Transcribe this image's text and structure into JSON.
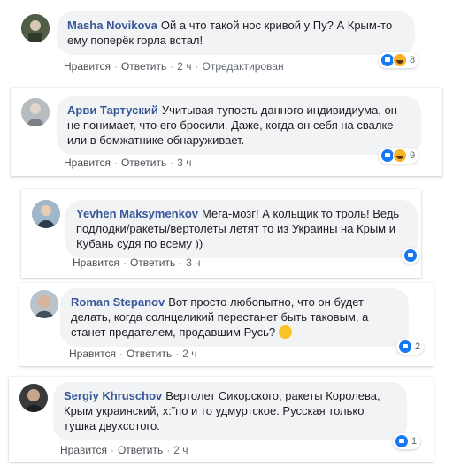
{
  "comments": [
    {
      "author": "Masha Novikova",
      "text": "Ой а что такой нос кривой у Пу? А Крым-то ему поперёк горла встал!",
      "like": "Нравится",
      "reply": "Ответить",
      "time": "2 ч",
      "edited": "Отредактирован",
      "reactions": "8"
    },
    {
      "author": "Арви Тартуский",
      "text": "Учитывая тупость данного индивидиума, он не понимает, что его бросили. Даже, когда он себя на свалке или в бомжатнике обнаруживает.",
      "like": "Нравится",
      "reply": "Ответить",
      "time": "3 ч",
      "reactions": "9"
    },
    {
      "author": "Yevhen Maksymenkov",
      "text": "Мега-мозг! А кольщик то троль! Ведь подлодки/ракеты/вертолеты летят то из Украины на Крым и Кубань судя по всему ))",
      "like": "Нравится",
      "reply": "Ответить",
      "time": "3 ч",
      "reactions": ""
    },
    {
      "author": "Roman Stepanov",
      "text": "Вот просто любопытно, что он будет делать, когда солнцеликий перестанет быть таковым, а станет предателем, продавшим Русь?",
      "like": "Нравится",
      "reply": "Ответить",
      "time": "2 ч",
      "reactions": "2"
    },
    {
      "author": "Sergiy Khruschov",
      "text": "Вертолет Сикорского, ракеты Королева, Крым украинский, х:˜по и то удмуртское. Русская только тушка двухсотого.",
      "like": "Нравится",
      "reply": "Ответить",
      "time": "2 ч",
      "reactions": "1"
    }
  ],
  "separator": "·"
}
